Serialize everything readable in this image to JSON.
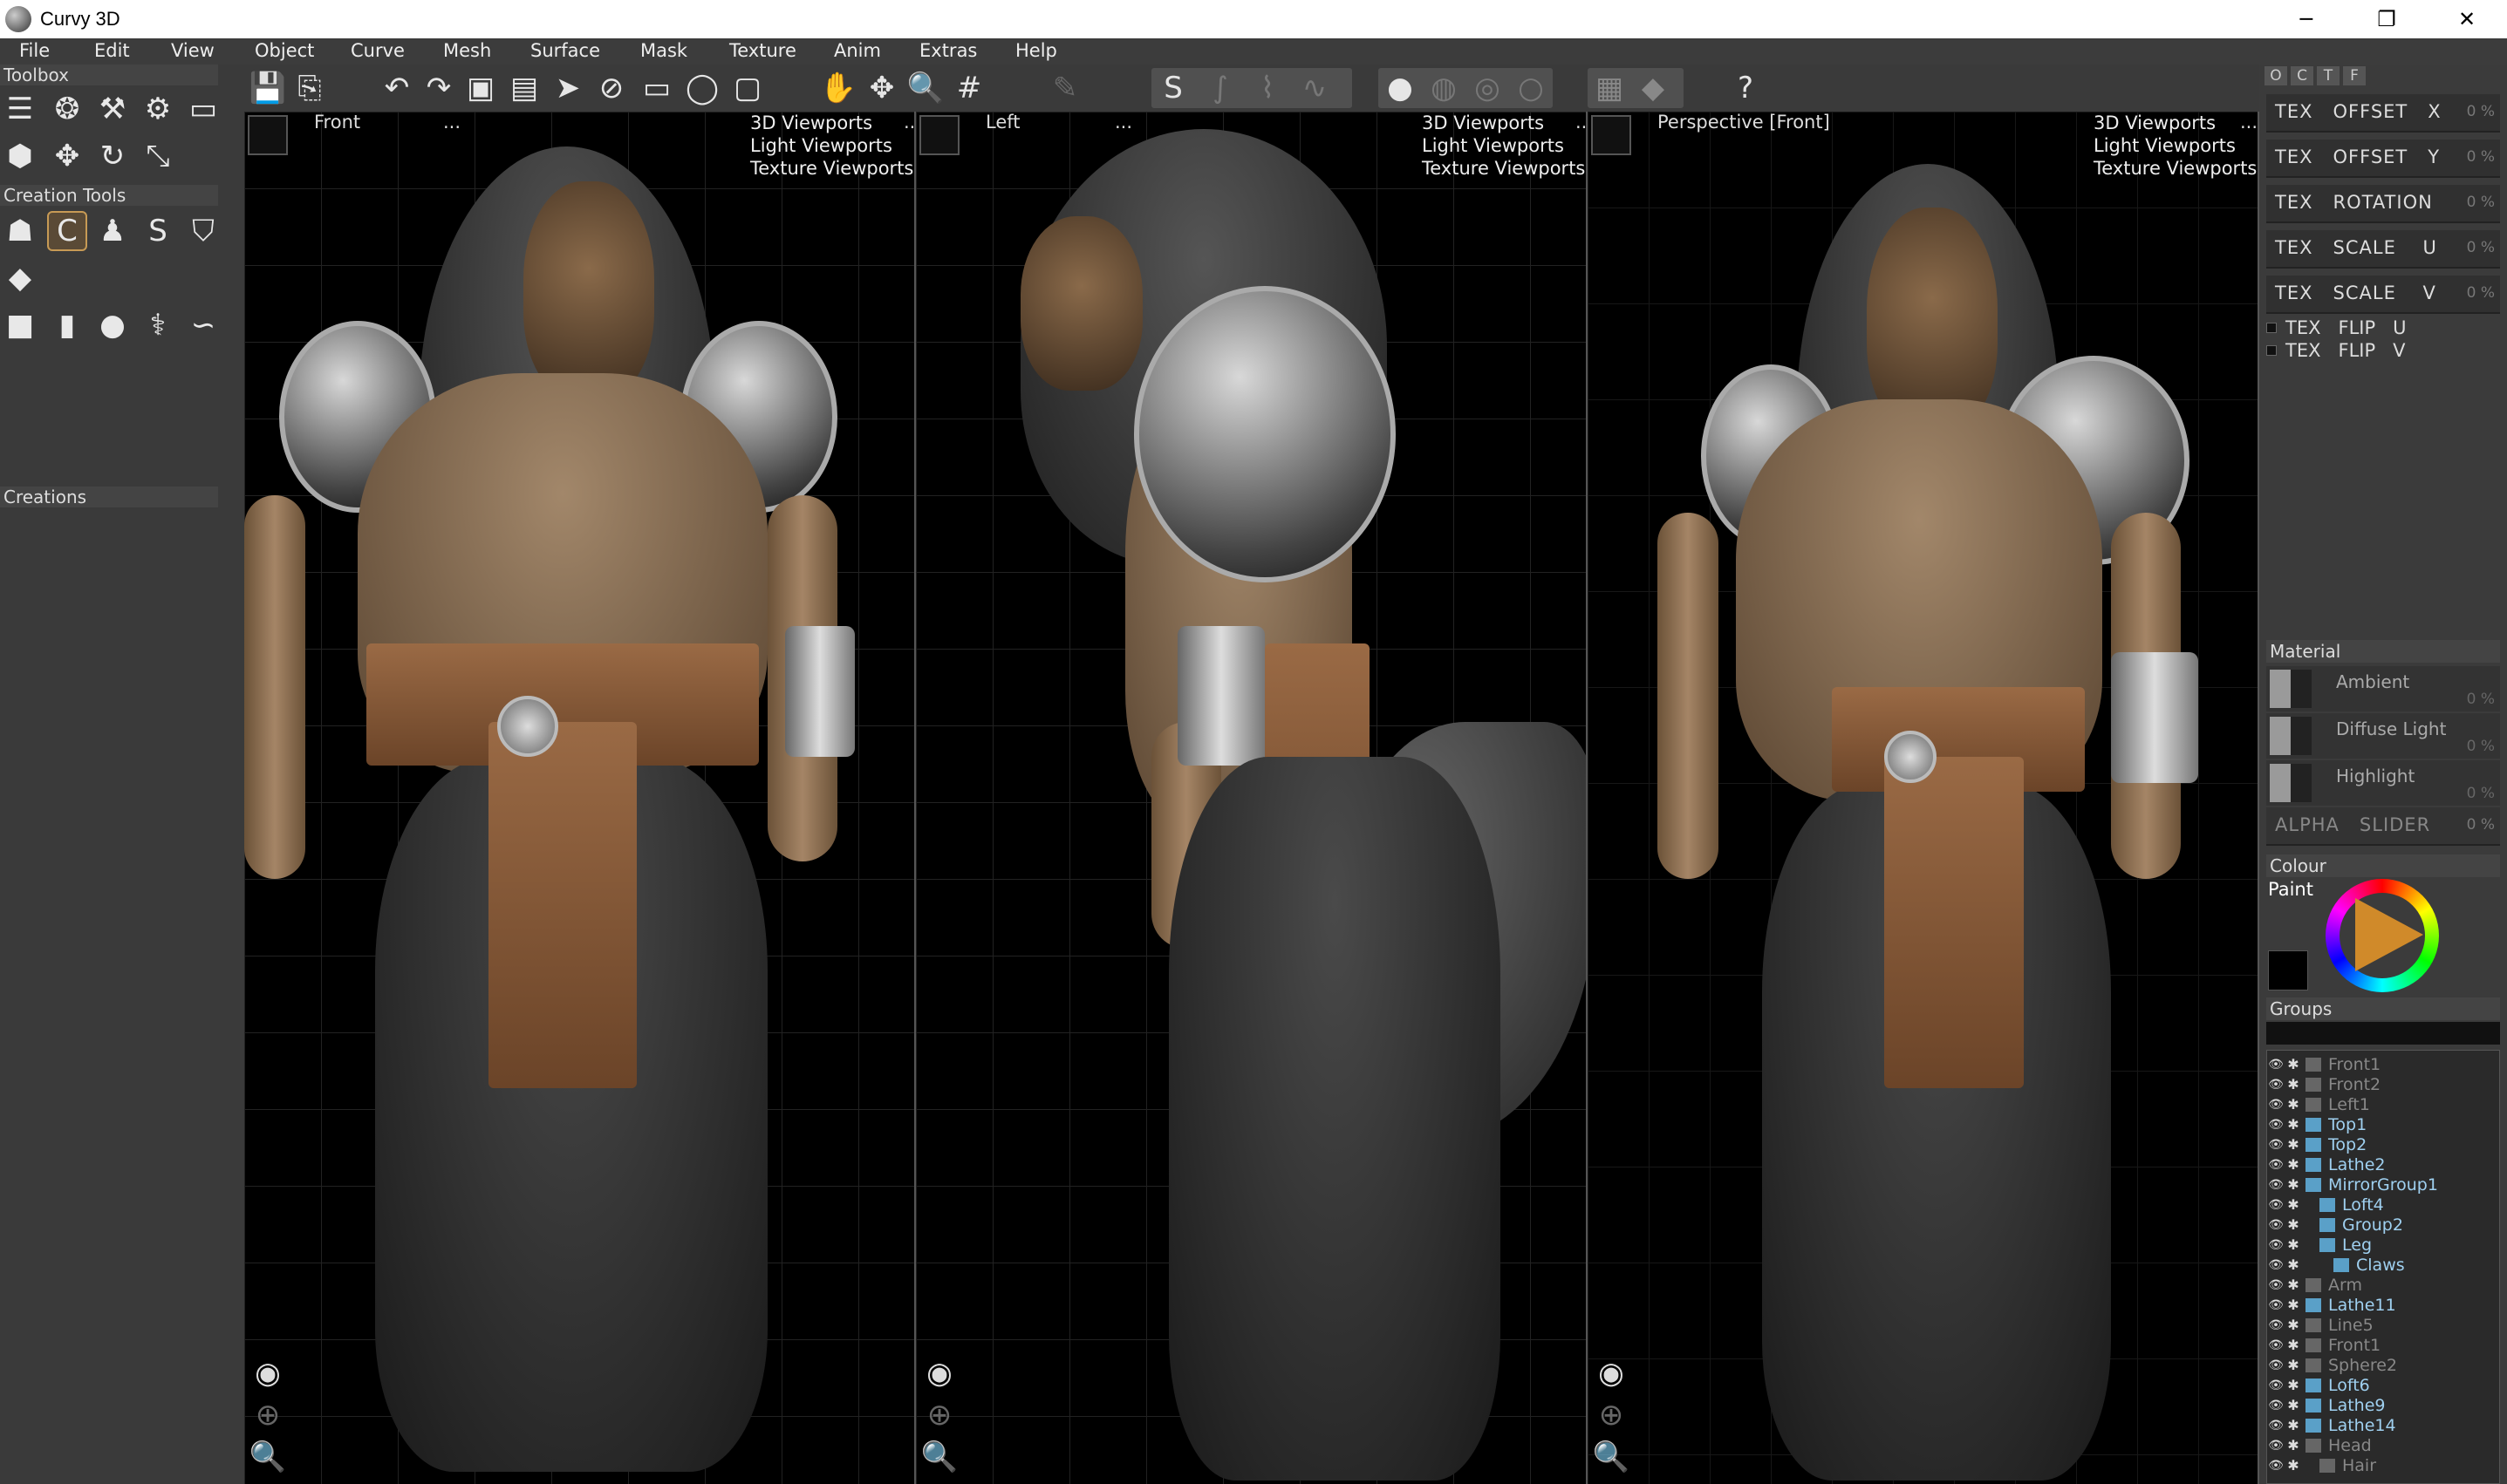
{
  "window": {
    "title": "Curvy 3D",
    "minimize": "─",
    "restore": "❐",
    "close": "✕"
  },
  "menu": [
    "File",
    "Edit",
    "View",
    "Object",
    "Curve",
    "Mesh",
    "Surface",
    "Mask",
    "Texture",
    "Anim",
    "Extras",
    "Help"
  ],
  "left_panel": {
    "toolbox_label": "Toolbox",
    "creation_tools_label": "Creation Tools",
    "creations_label": "Creations"
  },
  "viewports": [
    {
      "name": "Front",
      "dots": "...",
      "menu": [
        "3D Viewports",
        "Light Viewports",
        "Texture Viewports"
      ],
      "menu_dots": "..."
    },
    {
      "name": "Left",
      "dots": "...",
      "menu": [
        "3D Viewports",
        "Light Viewports",
        "Texture Viewports"
      ],
      "menu_dots": "..."
    },
    {
      "name": "Perspective [Front]",
      "menu": [
        "3D Viewports",
        "Light Viewports",
        "Texture Viewports"
      ],
      "menu_dots": "..."
    }
  ],
  "right_panel": {
    "tabs": [
      "O",
      "C",
      "T",
      "F"
    ],
    "tex_rows": [
      {
        "label": "TEX   OFFSET   X",
        "pct": "0 %"
      },
      {
        "label": "TEX   OFFSET   Y",
        "pct": "0 %"
      },
      {
        "label": "TEX   ROTATION",
        "pct": "0 %"
      },
      {
        "label": "TEX   SCALE    U",
        "pct": "0 %"
      },
      {
        "label": "TEX   SCALE    V",
        "pct": "0 %"
      }
    ],
    "flip_rows": [
      "TEX   FLIP   U",
      "TEX   FLIP   V"
    ],
    "material_label": "Material",
    "material_rows": [
      {
        "label": "Ambient",
        "pct": "0 %"
      },
      {
        "label": "Diffuse Light",
        "pct": "0 %"
      },
      {
        "label": "Highlight",
        "pct": "0 %"
      }
    ],
    "alpha_label": "ALPHA   SLIDER",
    "alpha_pct": "0 %",
    "colour_label": "Colour",
    "paint_label": "Paint",
    "groups_label": "Groups",
    "groups": [
      {
        "name": "Front1",
        "indent": 0,
        "dim": true
      },
      {
        "name": "Front2",
        "indent": 0,
        "dim": true
      },
      {
        "name": "Left1",
        "indent": 0,
        "dim": true
      },
      {
        "name": "Top1",
        "indent": 0,
        "dim": false
      },
      {
        "name": "Top2",
        "indent": 0,
        "dim": false
      },
      {
        "name": "Lathe2",
        "indent": 0,
        "dim": false
      },
      {
        "name": "MirrorGroup1",
        "indent": 0,
        "dim": false
      },
      {
        "name": "Loft4",
        "indent": 1,
        "dim": false
      },
      {
        "name": "Group2",
        "indent": 1,
        "dim": false
      },
      {
        "name": "Leg",
        "indent": 1,
        "dim": false
      },
      {
        "name": "Claws",
        "indent": 2,
        "dim": false
      },
      {
        "name": "Arm",
        "indent": 0,
        "dim": true
      },
      {
        "name": "Lathe11",
        "indent": 0,
        "dim": false
      },
      {
        "name": "Line5",
        "indent": 0,
        "dim": true
      },
      {
        "name": "Front1",
        "indent": 0,
        "dim": true
      },
      {
        "name": "Sphere2",
        "indent": 0,
        "dim": true
      },
      {
        "name": "Loft6",
        "indent": 0,
        "dim": false
      },
      {
        "name": "Lathe9",
        "indent": 0,
        "dim": false
      },
      {
        "name": "Lathe14",
        "indent": 0,
        "dim": false
      },
      {
        "name": "Head",
        "indent": 0,
        "dim": true
      },
      {
        "name": "Hair",
        "indent": 1,
        "dim": true
      }
    ]
  },
  "colors": {
    "accent": "#c79a55",
    "group_text": "#9fd0f0",
    "background": "#2f2f2f"
  }
}
